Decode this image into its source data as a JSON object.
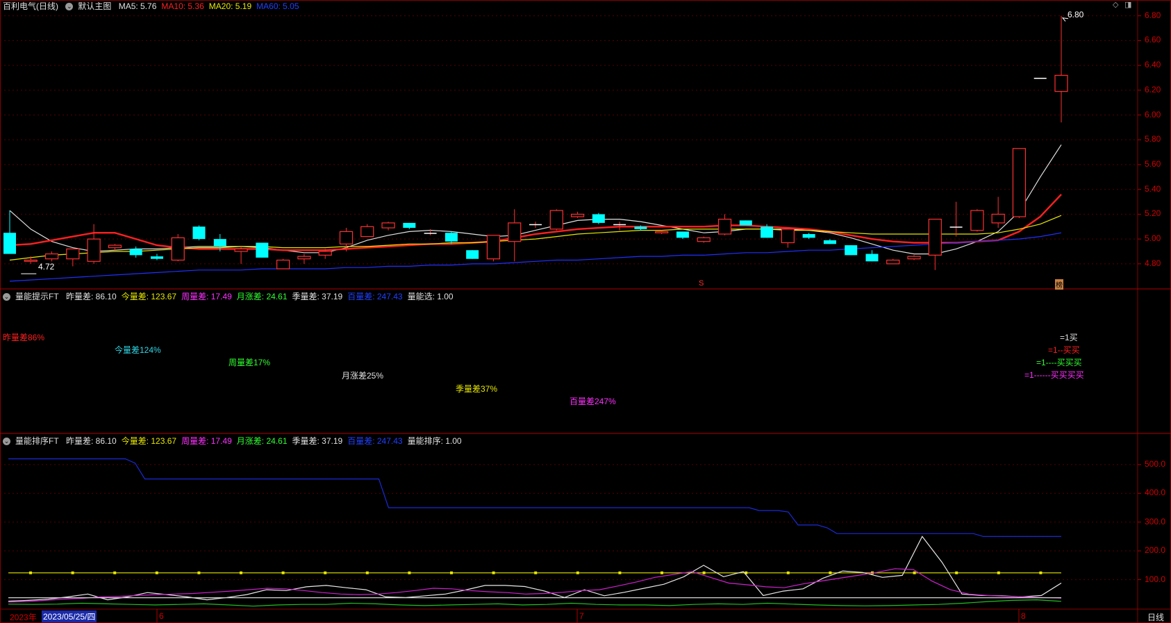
{
  "main_header": {
    "stock_title": "百利电气(日线)",
    "chart_name": "默认主图",
    "ma": [
      {
        "label": "MA5: 5.76",
        "color": "#e0e0e0"
      },
      {
        "label": "MA10: 5.36",
        "color": "#ff2020"
      },
      {
        "label": "MA20: 5.19",
        "color": "#e8e800"
      },
      {
        "label": "MA60: 5.05",
        "color": "#2040ff"
      }
    ]
  },
  "price_axis": [
    "6.80",
    "6.60",
    "6.40",
    "6.20",
    "6.00",
    "5.80",
    "5.60",
    "5.40",
    "5.20",
    "5.00",
    "4.80"
  ],
  "annotations": {
    "high_label": "6.80",
    "low_label": "4.72",
    "marker_s": "S",
    "marker_bang": "榜"
  },
  "panel2_header": {
    "name": "量能提示FT",
    "items": [
      {
        "label": "昨量差: 86.10",
        "color": "#e0e0e0"
      },
      {
        "label": "今量差: 123.67",
        "color": "#e8e800"
      },
      {
        "label": "周量差: 17.49",
        "color": "#ff30ff"
      },
      {
        "label": "月涨差: 24.61",
        "color": "#30ff30"
      },
      {
        "label": "季量差: 37.19",
        "color": "#e0e0e0"
      },
      {
        "label": "百量差: 247.43",
        "color": "#2040ff"
      },
      {
        "label": "量能选: 1.00",
        "color": "#e0e0e0"
      }
    ]
  },
  "panel2_texts": [
    {
      "text": "昨量差86%",
      "color": "#ff2020"
    },
    {
      "text": "今量差124%",
      "color": "#30d8e8"
    },
    {
      "text": "周量差17%",
      "color": "#30ff30"
    },
    {
      "text": "月涨差25%",
      "color": "#e0e0e0"
    },
    {
      "text": "季量差37%",
      "color": "#e8e800"
    },
    {
      "text": "百量差247%",
      "color": "#ff30ff"
    }
  ],
  "panel2_signals": [
    {
      "text": "=1买",
      "color": "#e0e0e0"
    },
    {
      "text": "=1--买买",
      "color": "#ff2020"
    },
    {
      "text": "=1----买买买",
      "color": "#30ff30"
    },
    {
      "text": "=1------买买买买",
      "color": "#ff30ff"
    }
  ],
  "panel3_header": {
    "name": "量能排序FT",
    "items": [
      {
        "label": "昨量差: 86.10",
        "color": "#e0e0e0"
      },
      {
        "label": "今量差: 123.67",
        "color": "#e8e800"
      },
      {
        "label": "周量差: 17.49",
        "color": "#ff30ff"
      },
      {
        "label": "月涨差: 24.61",
        "color": "#30ff30"
      },
      {
        "label": "季量差: 37.19",
        "color": "#e0e0e0"
      },
      {
        "label": "百量差: 247.43",
        "color": "#2040ff"
      },
      {
        "label": "量能排序: 1.00",
        "color": "#e0e0e0"
      }
    ]
  },
  "vol_axis": [
    "500.0",
    "400.0",
    "300.0",
    "200.0",
    "100.0"
  ],
  "date_axis": {
    "year": "2023年",
    "cursor_date": "2023/05/25/四",
    "months": [
      "6",
      "7",
      "8"
    ],
    "period": "日线"
  },
  "chart_data": [
    {
      "type": "candlestick",
      "ylim": [
        4.62,
        6.86
      ],
      "series": [
        {
          "ohlc": [
            [
              5.05,
              5.23,
              4.89,
              4.88
            ],
            [
              4.82,
              4.86,
              4.8,
              4.83
            ],
            [
              4.84,
              4.9,
              4.82,
              4.88
            ],
            [
              4.84,
              4.92,
              4.78,
              4.92
            ],
            [
              4.82,
              5.12,
              4.8,
              5.0
            ],
            [
              4.93,
              4.96,
              4.91,
              4.95
            ],
            [
              4.92,
              4.94,
              4.85,
              4.87
            ],
            [
              4.86,
              4.88,
              4.83,
              4.84
            ],
            [
              4.83,
              5.04,
              4.82,
              5.01
            ],
            [
              5.1,
              5.11,
              4.99,
              5.0
            ],
            [
              5.0,
              5.04,
              4.9,
              4.94
            ],
            [
              4.9,
              4.94,
              4.8,
              4.92
            ],
            [
              4.97,
              4.97,
              4.85,
              4.85
            ],
            [
              4.76,
              4.84,
              4.76,
              4.83
            ],
            [
              4.84,
              4.88,
              4.8,
              4.86
            ],
            [
              4.87,
              4.92,
              4.84,
              4.9
            ],
            [
              4.96,
              5.09,
              4.9,
              5.06
            ],
            [
              5.02,
              5.12,
              5.02,
              5.1
            ],
            [
              5.09,
              5.14,
              5.07,
              5.13
            ],
            [
              5.13,
              5.13,
              5.08,
              5.09
            ],
            [
              5.05,
              5.08,
              5.03,
              5.05
            ],
            [
              5.05,
              5.06,
              4.96,
              4.98
            ],
            [
              4.91,
              4.91,
              4.84,
              4.84
            ],
            [
              4.84,
              5.03,
              4.82,
              5.03
            ],
            [
              4.98,
              5.24,
              4.82,
              5.13
            ],
            [
              5.12,
              5.14,
              5.09,
              5.12
            ],
            [
              5.08,
              5.24,
              5.07,
              5.23
            ],
            [
              5.18,
              5.22,
              5.17,
              5.2
            ],
            [
              5.2,
              5.21,
              5.12,
              5.13
            ],
            [
              5.12,
              5.14,
              5.07,
              5.12
            ],
            [
              5.1,
              5.11,
              5.07,
              5.08
            ],
            [
              5.05,
              5.07,
              5.04,
              5.06
            ],
            [
              5.06,
              5.06,
              5.0,
              5.01
            ],
            [
              4.98,
              5.02,
              4.97,
              5.01
            ],
            [
              5.04,
              5.2,
              5.03,
              5.16
            ],
            [
              5.15,
              5.15,
              5.11,
              5.11
            ],
            [
              5.1,
              5.12,
              5.01,
              5.01
            ],
            [
              4.97,
              5.08,
              4.93,
              5.08
            ],
            [
              5.04,
              5.05,
              5.0,
              5.01
            ],
            [
              4.99,
              5.0,
              4.96,
              4.96
            ],
            [
              4.95,
              4.95,
              4.87,
              4.87
            ],
            [
              4.88,
              4.91,
              4.82,
              4.82
            ],
            [
              4.8,
              4.84,
              4.8,
              4.83
            ],
            [
              4.84,
              4.87,
              4.83,
              4.86
            ],
            [
              4.87,
              5.16,
              4.75,
              5.16
            ],
            [
              5.1,
              5.3,
              5.02,
              5.1
            ],
            [
              5.07,
              5.24,
              5.06,
              5.23
            ],
            [
              5.13,
              5.34,
              5.09,
              5.2
            ],
            [
              5.18,
              5.73,
              5.17,
              5.73
            ],
            [
              6.3,
              6.3,
              6.3,
              6.3
            ],
            [
              6.19,
              6.8,
              5.94,
              6.32
            ]
          ]
        },
        {
          "name": "MA5",
          "values": [
            5.23,
            5.08,
            4.98,
            4.93,
            4.9,
            4.91,
            4.92,
            4.92,
            4.93,
            4.94,
            4.94,
            4.94,
            4.93,
            4.91,
            4.89,
            4.89,
            4.93,
            4.99,
            5.03,
            5.06,
            5.07,
            5.06,
            5.04,
            5.02,
            5.03,
            5.07,
            5.11,
            5.15,
            5.16,
            5.16,
            5.14,
            5.11,
            5.08,
            5.05,
            5.06,
            5.08,
            5.08,
            5.08,
            5.07,
            5.05,
            5.01,
            4.96,
            4.91,
            4.88,
            4.88,
            4.92,
            4.98,
            5.06,
            5.22,
            5.5,
            5.76
          ]
        },
        {
          "name": "MA10",
          "values": [
            4.95,
            4.96,
            4.99,
            5.02,
            5.05,
            5.05,
            5.0,
            4.95,
            4.93,
            4.92,
            4.92,
            4.92,
            4.92,
            4.91,
            4.91,
            4.91,
            4.92,
            4.93,
            4.94,
            4.95,
            4.96,
            4.96,
            4.97,
            4.98,
            5.01,
            5.04,
            5.06,
            5.08,
            5.09,
            5.1,
            5.1,
            5.1,
            5.1,
            5.1,
            5.11,
            5.11,
            5.1,
            5.09,
            5.08,
            5.06,
            5.03,
            5.0,
            4.98,
            4.97,
            4.97,
            4.97,
            4.98,
            4.99,
            5.06,
            5.18,
            5.36
          ]
        },
        {
          "name": "MA20",
          "values": [
            4.83,
            4.85,
            4.87,
            4.88,
            4.89,
            4.9,
            4.9,
            4.91,
            4.92,
            4.93,
            4.93,
            4.94,
            4.94,
            4.93,
            4.93,
            4.93,
            4.94,
            4.94,
            4.95,
            4.96,
            4.96,
            4.97,
            4.97,
            4.98,
            4.99,
            5.0,
            5.02,
            5.04,
            5.05,
            5.06,
            5.07,
            5.07,
            5.08,
            5.08,
            5.08,
            5.08,
            5.08,
            5.07,
            5.07,
            5.06,
            5.05,
            5.04,
            5.04,
            5.04,
            5.04,
            5.04,
            5.04,
            5.05,
            5.08,
            5.12,
            5.19
          ]
        },
        {
          "name": "MA60",
          "values": [
            4.66,
            4.67,
            4.68,
            4.69,
            4.7,
            4.71,
            4.72,
            4.73,
            4.74,
            4.75,
            4.75,
            4.75,
            4.76,
            4.76,
            4.76,
            4.76,
            4.77,
            4.77,
            4.78,
            4.78,
            4.79,
            4.79,
            4.8,
            4.8,
            4.81,
            4.82,
            4.83,
            4.83,
            4.84,
            4.85,
            4.86,
            4.86,
            4.87,
            4.87,
            4.88,
            4.89,
            4.89,
            4.9,
            4.91,
            4.91,
            4.92,
            4.93,
            4.94,
            4.95,
            4.96,
            4.97,
            4.98,
            4.99,
            5.0,
            5.02,
            5.05
          ]
        }
      ]
    },
    {
      "type": "line",
      "ylim": [
        0,
        560
      ],
      "series": [
        {
          "name": "百量差",
          "values": [
            520,
            520,
            520,
            520,
            520,
            520,
            520,
            520,
            520,
            520,
            520,
            520,
            520,
            505,
            450,
            450,
            450,
            450,
            450,
            450,
            450,
            450,
            450,
            450,
            450,
            450,
            450,
            450,
            450,
            450,
            450,
            450,
            450,
            450,
            450,
            450,
            450,
            450,
            450,
            350,
            350,
            350,
            350,
            350,
            350,
            350,
            350,
            350,
            350,
            350,
            350,
            350,
            350,
            350,
            350,
            350,
            350,
            350,
            350,
            350,
            350,
            350,
            350,
            350,
            350,
            350,
            350,
            350,
            350,
            350,
            350,
            350,
            350,
            350,
            350,
            350,
            350,
            340,
            340,
            340,
            335,
            290,
            290,
            290,
            280,
            260,
            260,
            260,
            260,
            260,
            260,
            260,
            260,
            260,
            260,
            260,
            260,
            260,
            260,
            260,
            250,
            250,
            250,
            250,
            250,
            250,
            250,
            250,
            250
          ]
        },
        {
          "name": "今量差",
          "values": [
            123.67,
            123.67,
            123.67,
            123.67,
            123.67,
            123.67,
            123.67,
            123.67,
            123.67,
            123.67,
            123.67,
            123.67,
            123.67,
            123.67,
            123.67,
            123.67,
            123.67,
            123.67,
            123.67,
            123.67,
            123.67,
            123.67,
            123.67,
            123.67,
            123.67,
            123.67
          ]
        },
        {
          "name": "昨量差",
          "values": [
            25,
            28,
            32,
            40,
            50,
            30,
            40,
            55,
            48,
            40,
            30,
            38,
            48,
            65,
            62,
            75,
            80,
            72,
            65,
            40,
            38,
            44,
            50,
            64,
            80,
            80,
            76,
            60,
            38,
            65,
            44,
            56,
            70,
            84,
            110,
            150,
            110,
            128,
            45,
            60,
            68,
            105,
            130,
            125,
            108,
            115,
            250,
            160,
            50,
            45,
            44,
            40,
            45,
            88
          ]
        },
        {
          "name": "周量差",
          "values": [
            22,
            24,
            28,
            32,
            35,
            40,
            42,
            45,
            48,
            50,
            52,
            56,
            60,
            65,
            70,
            68,
            62,
            55,
            50,
            48,
            50,
            55,
            62,
            70,
            68,
            62,
            58,
            55,
            50,
            52,
            56,
            62,
            65,
            78,
            92,
            108,
            118,
            128,
            108,
            88,
            82,
            75,
            72,
            85,
            95,
            105,
            115,
            125,
            138,
            135,
            95,
            65,
            50,
            45,
            42,
            40,
            38,
            36
          ]
        },
        {
          "name": "季量差",
          "values": [
            37.19,
            37.19,
            37.19,
            37.19,
            37.19,
            37.19,
            37.19,
            37.19,
            37.19,
            37.19,
            37.19,
            37.19,
            37.19,
            37.19,
            37.19,
            37.19,
            37.19,
            37.19,
            37.19,
            37.19
          ]
        },
        {
          "name": "月涨差",
          "values": [
            15,
            14,
            15,
            18,
            16,
            14,
            12,
            14,
            16,
            12,
            8,
            12,
            14,
            14,
            18,
            16,
            12,
            10,
            12,
            14,
            16,
            12,
            14,
            18,
            14,
            12,
            12,
            10,
            14,
            16,
            14,
            18,
            15,
            12,
            10,
            9,
            10,
            12,
            14,
            18,
            24,
            28,
            30,
            24.61
          ]
        }
      ]
    }
  ]
}
